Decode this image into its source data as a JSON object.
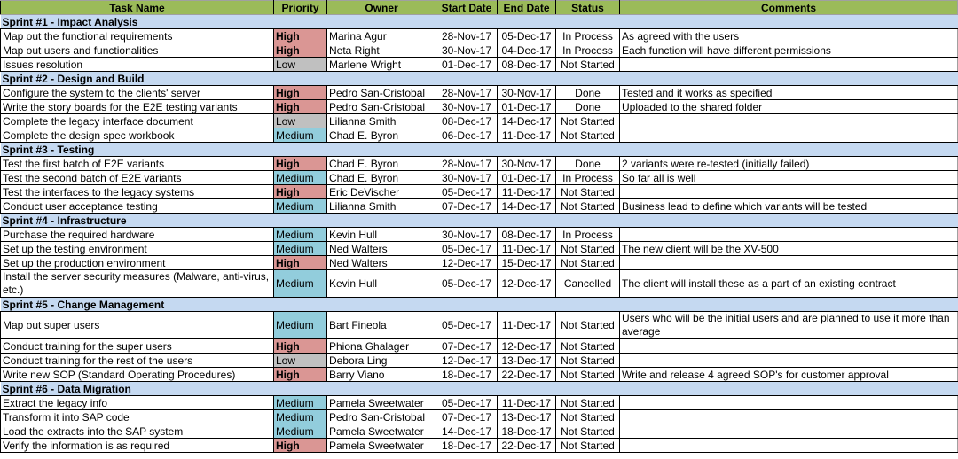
{
  "columns": {
    "task": "Task Name",
    "priority": "Priority",
    "owner": "Owner",
    "start": "Start Date",
    "end": "End Date",
    "status": "Status",
    "comments": "Comments"
  },
  "priority_colors": {
    "High": "#da9694",
    "Medium": "#92cddc",
    "Low": "#c0c0c0"
  },
  "sprints": [
    {
      "title": "Sprint #1 - Impact Analysis",
      "tasks": [
        {
          "task": "Map out the functional requirements",
          "priority": "High",
          "owner": "Marina Agur",
          "start": "28-Nov-17",
          "end": "05-Dec-17",
          "status": "In Process",
          "comments": "As agreed with the users"
        },
        {
          "task": "Map out users and functionalities",
          "priority": "High",
          "owner": "Neta Right",
          "start": "30-Nov-17",
          "end": "04-Dec-17",
          "status": "In Process",
          "comments": "Each function will have different permissions"
        },
        {
          "task": "Issues resolution",
          "priority": "Low",
          "owner": "Marlene Wright",
          "start": "01-Dec-17",
          "end": "08-Dec-17",
          "status": "Not Started",
          "comments": ""
        }
      ]
    },
    {
      "title": "Sprint #2 - Design and Build",
      "tasks": [
        {
          "task": "Configure the system to the clients' server",
          "priority": "High",
          "owner": "Pedro San-Cristobal",
          "start": "28-Nov-17",
          "end": "30-Nov-17",
          "status": "Done",
          "comments": "Tested and it works as specified"
        },
        {
          "task": "Write the story boards for the E2E testing variants",
          "priority": "High",
          "owner": "Pedro San-Cristobal",
          "start": "30-Nov-17",
          "end": "01-Dec-17",
          "status": "Done",
          "comments": "Uploaded to the shared folder"
        },
        {
          "task": "Complete the legacy interface document",
          "priority": "Low",
          "owner": "Lilianna Smith",
          "start": "08-Dec-17",
          "end": "14-Dec-17",
          "status": "Not Started",
          "comments": ""
        },
        {
          "task": "Complete the design spec workbook",
          "priority": "Medium",
          "owner": "Chad E. Byron",
          "start": "06-Dec-17",
          "end": "11-Dec-17",
          "status": "Not Started",
          "comments": ""
        }
      ]
    },
    {
      "title": "Sprint #3 - Testing",
      "tasks": [
        {
          "task": "Test the first batch of E2E variants",
          "priority": "High",
          "owner": "Chad E. Byron",
          "start": "28-Nov-17",
          "end": "30-Nov-17",
          "status": "Done",
          "comments": "2 variants were re-tested (initially failed)"
        },
        {
          "task": "Test the second batch of E2E variants",
          "priority": "Medium",
          "owner": "Chad E. Byron",
          "start": "30-Nov-17",
          "end": "01-Dec-17",
          "status": "In Process",
          "comments": "So far all is well"
        },
        {
          "task": "Test the interfaces to the legacy systems",
          "priority": "High",
          "owner": "Eric DeVischer",
          "start": "05-Dec-17",
          "end": "11-Dec-17",
          "status": "Not Started",
          "comments": ""
        },
        {
          "task": "Conduct user acceptance testing",
          "priority": "Medium",
          "owner": "Lilianna Smith",
          "start": "07-Dec-17",
          "end": "14-Dec-17",
          "status": "Not Started",
          "comments": "Business lead to define which variants will be tested"
        }
      ]
    },
    {
      "title": "Sprint #4 - Infrastructure",
      "tasks": [
        {
          "task": "Purchase the required hardware",
          "priority": "Medium",
          "owner": "Kevin Hull",
          "start": "30-Nov-17",
          "end": "08-Dec-17",
          "status": "In Process",
          "comments": ""
        },
        {
          "task": "Set up the testing environment",
          "priority": "Medium",
          "owner": "Ned Walters",
          "start": "05-Dec-17",
          "end": "11-Dec-17",
          "status": "Not Started",
          "comments": "The new client will be the XV-500"
        },
        {
          "task": "Set up the production environment",
          "priority": "High",
          "owner": "Ned Walters",
          "start": "12-Dec-17",
          "end": "15-Dec-17",
          "status": "Not Started",
          "comments": ""
        },
        {
          "task": "Install the server security measures (Malware, anti-virus, etc.)",
          "priority": "Medium",
          "owner": "Kevin Hull",
          "start": "05-Dec-17",
          "end": "12-Dec-17",
          "status": "Cancelled",
          "comments": "The client will install these as a part of an existing contract",
          "tall": true
        }
      ]
    },
    {
      "title": "Sprint #5 - Change Management",
      "tasks": [
        {
          "task": "Map out super users",
          "priority": "Medium",
          "owner": "Bart Fineola",
          "start": "05-Dec-17",
          "end": "11-Dec-17",
          "status": "Not Started",
          "comments": "Users who will be the initial users and are planned to use it more than average",
          "tall": true
        },
        {
          "task": "Conduct training for the super users",
          "priority": "High",
          "owner": "Phiona Ghalager",
          "start": "07-Dec-17",
          "end": "12-Dec-17",
          "status": "Not Started",
          "comments": ""
        },
        {
          "task": "Conduct training for the rest of the users",
          "priority": "Low",
          "owner": "Debora Ling",
          "start": "12-Dec-17",
          "end": "13-Dec-17",
          "status": "Not Started",
          "comments": ""
        },
        {
          "task": "Write new SOP (Standard Operating Procedures)",
          "priority": "High",
          "owner": "Barry Viano",
          "start": "18-Dec-17",
          "end": "22-Dec-17",
          "status": "Not Started",
          "comments": "Write and release 4 agreed SOP's for customer approval"
        }
      ]
    },
    {
      "title": "Sprint #6 - Data Migration",
      "tasks": [
        {
          "task": "Extract the legacy info",
          "priority": "Medium",
          "owner": "Pamela Sweetwater",
          "start": "05-Dec-17",
          "end": "11-Dec-17",
          "status": "Not Started",
          "comments": ""
        },
        {
          "task": "Transform it into SAP code",
          "priority": "Medium",
          "owner": "Pedro San-Cristobal",
          "start": "07-Dec-17",
          "end": "13-Dec-17",
          "status": "Not Started",
          "comments": ""
        },
        {
          "task": "Load the extracts into the SAP system",
          "priority": "Medium",
          "owner": "Pamela Sweetwater",
          "start": "14-Dec-17",
          "end": "18-Dec-17",
          "status": "Not Started",
          "comments": ""
        },
        {
          "task": "Verify the information is as required",
          "priority": "High",
          "owner": "Pamela Sweetwater",
          "start": "18-Dec-17",
          "end": "22-Dec-17",
          "status": "Not Started",
          "comments": ""
        }
      ]
    }
  ]
}
